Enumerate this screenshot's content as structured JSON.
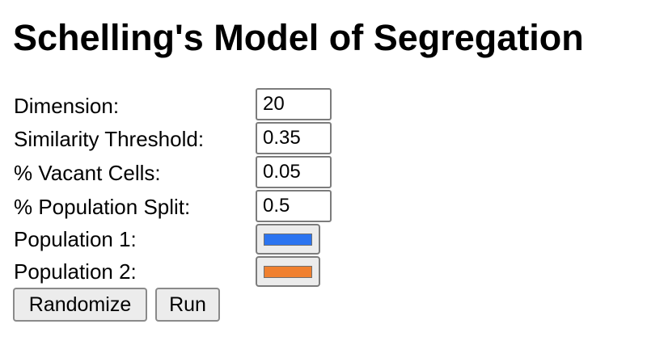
{
  "page": {
    "title": "Schelling's Model of Segregation"
  },
  "form": {
    "dimension": {
      "label": "Dimension:",
      "value": "20"
    },
    "similarity_threshold": {
      "label": "Similarity Threshold:",
      "value": "0.35"
    },
    "vacant_cells": {
      "label": "% Vacant Cells:",
      "value": "0.05"
    },
    "population_split": {
      "label": "% Population Split:",
      "value": "0.5"
    },
    "population1": {
      "label": "Population 1:",
      "color": "#2b74f0"
    },
    "population2": {
      "label": "Population 2:",
      "color": "#f0802f"
    }
  },
  "buttons": {
    "randomize_label": "Randomize",
    "run_label": "Run"
  }
}
